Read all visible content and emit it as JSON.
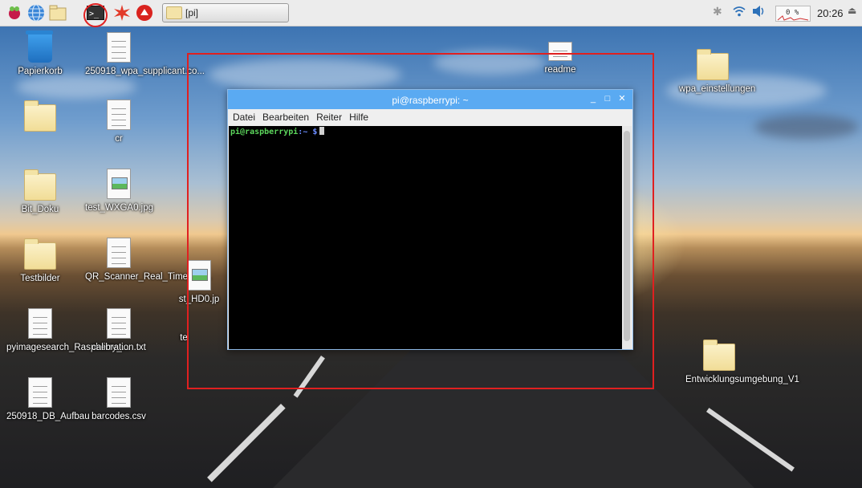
{
  "panel": {
    "task_button_label": "[pi]",
    "clock": "20:26",
    "cpu_usage": "0 %"
  },
  "desktop_icons": [
    {
      "label": "Papierkorb"
    },
    {
      "label": "250918_wpa_supplicant.co..."
    },
    {
      "label": ""
    },
    {
      "label": "cr"
    },
    {
      "label": "Bit_Doku"
    },
    {
      "label": "test_WXGA0.jpg"
    },
    {
      "label": "Testbilder"
    },
    {
      "label": "QR_Scanner_Real_Time_RJ..."
    },
    {
      "label": "pyimagesearch_Raspberry_..."
    },
    {
      "label": "calibration.txt"
    },
    {
      "label": "250918_DB_Aufbau"
    },
    {
      "label": "barcodes.csv"
    },
    {
      "label": "readme"
    },
    {
      "label": "wpa_einstellungen"
    },
    {
      "label": "Entwicklungsumgebung_V1"
    },
    {
      "label": "st_HD0.jp"
    },
    {
      "label": "te"
    }
  ],
  "terminal": {
    "title": "pi@raspberrypi: ~",
    "menu": [
      "Datei",
      "Bearbeiten",
      "Reiter",
      "Hilfe"
    ],
    "prompt_user": "pi@raspberrypi",
    "prompt_path": ":~ $",
    "window_controls": {
      "minimize": "_",
      "maximize": "□",
      "close": "✕"
    }
  },
  "colors": {
    "titlebar": "#5aaaf2",
    "highlight": "#e02020",
    "prompt_user": "#5cd65c",
    "prompt_path": "#6a8cff"
  }
}
